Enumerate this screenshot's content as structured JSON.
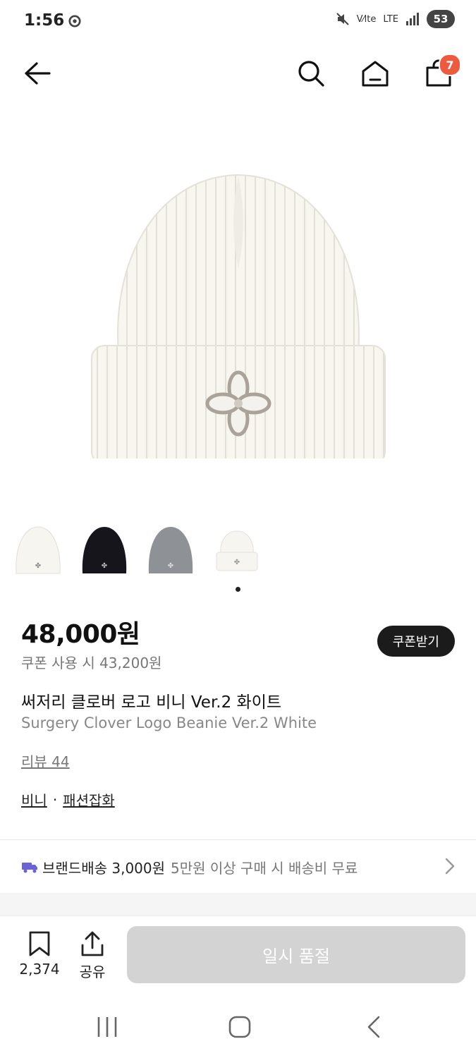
{
  "status_bar": {
    "time": "1:56",
    "network": "LTE",
    "battery": "53"
  },
  "nav": {
    "cart_count": "7"
  },
  "product": {
    "price": "48,000원",
    "coupon_price": "쿠폰 사용 시 43,200원",
    "coupon_button": "쿠폰받기",
    "title_ko": "써저리 클로버 로고 비니 Ver.2 화이트",
    "title_en": "Surgery Clover Logo Beanie Ver.2 White",
    "reviews": "리뷰 44",
    "category_1": "비니",
    "category_sep": "·",
    "category_2": "패션잡화"
  },
  "shipping": {
    "label": "브랜드배송 3,000원",
    "note": "5만원 이상 구매 시 배송비 무료"
  },
  "bottom": {
    "bookmark_count": "2,374",
    "share_label": "공유",
    "soldout_label": "일시 품절"
  },
  "colors": {
    "accent_badge": "#ee5a40",
    "soldout_bg": "#d3d3d3",
    "ship_icon": "#6b63d9"
  }
}
